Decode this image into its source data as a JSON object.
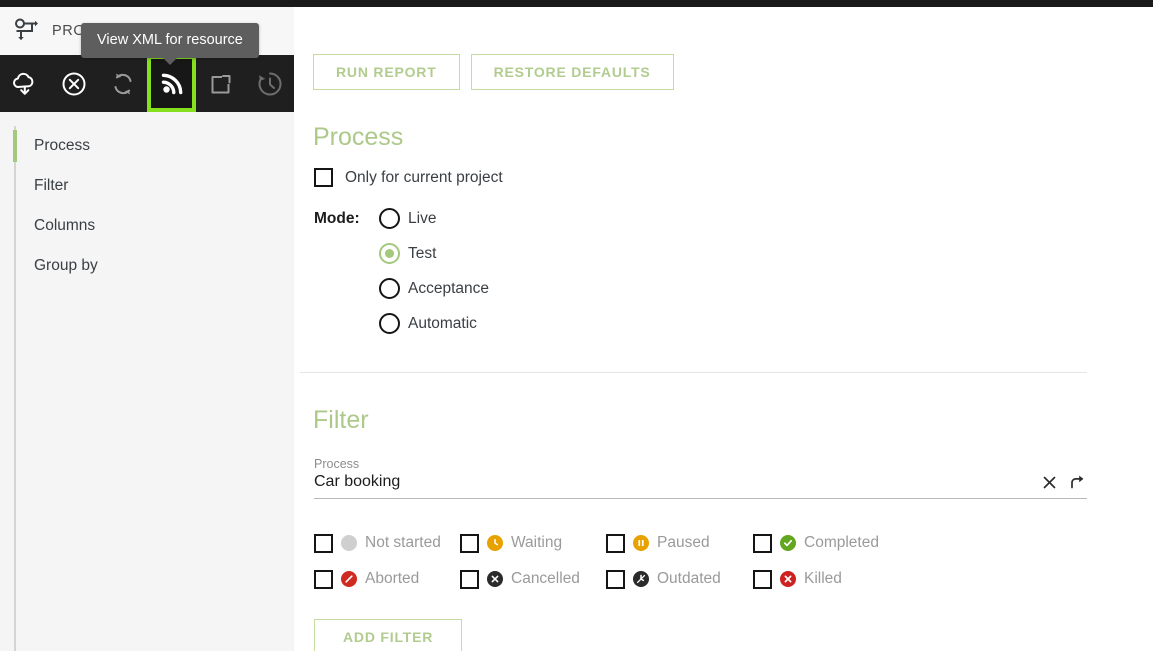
{
  "app": {
    "title": "PROCESS REPORTS",
    "header_icon": "process-flow-icon"
  },
  "tooltip": {
    "text": "View XML for resource"
  },
  "toolbar": {
    "items": [
      {
        "name": "deploy-cloud-icon",
        "label": "Deploy",
        "selected": false
      },
      {
        "name": "undeploy-circle-x-icon",
        "label": "Undeploy",
        "selected": false
      },
      {
        "name": "refresh-sync-icon",
        "label": "Refresh",
        "selected": false
      },
      {
        "name": "view-xml-feed-icon",
        "label": "View XML for resource",
        "selected": true
      },
      {
        "name": "open-external-icon",
        "label": "Open external",
        "selected": false
      },
      {
        "name": "history-clock-icon",
        "label": "History",
        "selected": false
      }
    ]
  },
  "sidebar": {
    "items": [
      {
        "label": "Process",
        "active": true
      },
      {
        "label": "Filter",
        "active": false
      },
      {
        "label": "Columns",
        "active": false
      },
      {
        "label": "Group by",
        "active": false
      }
    ]
  },
  "toolbar_buttons": {
    "run_report": "RUN REPORT",
    "restore_defaults": "RESTORE DEFAULTS"
  },
  "process_section": {
    "title": "Process",
    "only_current_project": {
      "label": "Only for current project",
      "checked": false
    },
    "mode": {
      "label": "Mode:",
      "selected": "Test",
      "options": [
        {
          "label": "Live",
          "checked": false
        },
        {
          "label": "Test",
          "checked": true
        },
        {
          "label": "Acceptance",
          "checked": false
        },
        {
          "label": "Automatic",
          "checked": false
        }
      ]
    }
  },
  "filter_section": {
    "title": "Filter",
    "process_field": {
      "label": "Process",
      "value": "Car booking",
      "placeholder": "Process",
      "clear_icon": "close-x-icon",
      "goto_icon": "arrow-curve-right-icon"
    },
    "statuses": [
      {
        "label": "Not started",
        "checked": false,
        "icon": "circle-gray-icon",
        "color": "#cfcfcf",
        "glyph": ""
      },
      {
        "label": "Waiting",
        "checked": false,
        "icon": "clock-icon",
        "color": "#e8a200",
        "glyph": "clock"
      },
      {
        "label": "Paused",
        "checked": false,
        "icon": "pause-icon",
        "color": "#e8a200",
        "glyph": "pause"
      },
      {
        "label": "Completed",
        "checked": false,
        "icon": "check-circle-icon",
        "color": "#63a620",
        "glyph": "check"
      },
      {
        "label": "Aborted",
        "checked": false,
        "icon": "slash-circle-icon",
        "color": "#d02b20",
        "glyph": "slash"
      },
      {
        "label": "Cancelled",
        "checked": false,
        "icon": "cancel-x-icon",
        "color": "#2b2b2b",
        "glyph": "x"
      },
      {
        "label": "Outdated",
        "checked": false,
        "icon": "outdated-clock-icon",
        "color": "#2b2b2b",
        "glyph": "outdated"
      },
      {
        "label": "Killed",
        "checked": false,
        "icon": "killed-x-icon",
        "color": "#cc2222",
        "glyph": "x"
      }
    ],
    "add_filter_label": "ADD FILTER"
  },
  "colors": {
    "accent_green": "#a4c87c",
    "button_border": "#c4dba2",
    "selection_highlight": "#86e01e",
    "toolbar_bg": "#1f1f1f",
    "sidebar_bg": "#f5f5f5"
  }
}
